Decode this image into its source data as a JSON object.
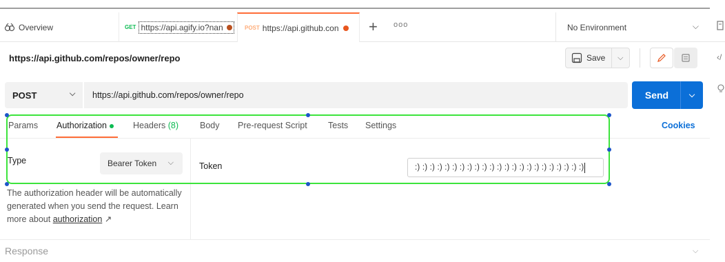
{
  "tabs": {
    "overview_label": "Overview",
    "get_tab": {
      "method": "GET",
      "url": "https://api.agify.io?nan"
    },
    "post_tab": {
      "method": "POST",
      "url": "https://api.github.con"
    },
    "add_label": "+",
    "more_label": "ooo",
    "environment": "No Environment"
  },
  "request": {
    "title": "https://api.github.com/repos/owner/repo",
    "save_label": "Save",
    "method": "POST",
    "url": "https://api.github.com/repos/owner/repo",
    "send_label": "Send"
  },
  "request_tabs": {
    "params": "Params",
    "authorization": "Authorization",
    "headers": "Headers",
    "headers_count": "(8)",
    "body": "Body",
    "prerequest": "Pre-request Script",
    "tests": "Tests",
    "settings": "Settings",
    "cookies": "Cookies"
  },
  "auth": {
    "type_label": "Type",
    "type_value": "Bearer Token",
    "help_text": "The authorization header will be automatically generated when you send the request. Learn more about ",
    "help_link": "authorization",
    "help_arrow": "↗",
    "token_label": "Token",
    "token_value": ":) :) :) :) :) :) :) :) :) :) :) :) :) :) :) :) :) :) :) :) :) :) :)"
  },
  "response_label": "Response",
  "colors": {
    "accent_orange": "#ff6c37",
    "send_blue": "#0b6fd8",
    "selection_green": "#3ce43c",
    "handle_blue": "#1d55c9"
  }
}
